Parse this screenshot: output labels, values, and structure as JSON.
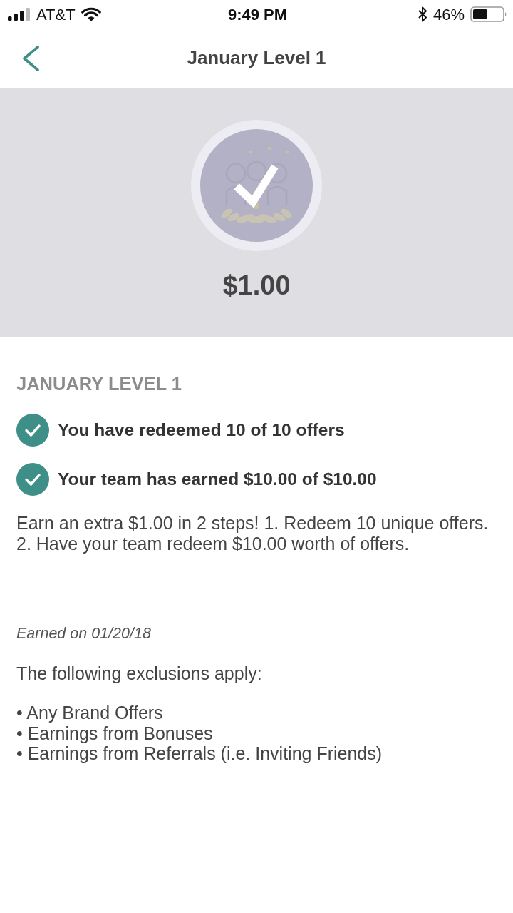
{
  "status_bar": {
    "carrier": "AT&T",
    "time": "9:49 PM",
    "battery": "46%"
  },
  "nav_bar": {
    "title": "January Level 1"
  },
  "hero": {
    "earned": true,
    "amount": "$1.00"
  },
  "section": {
    "heading": "JANUARY LEVEL 1",
    "requirements": [
      {
        "text": "You have redeemed 10 of 10 offers",
        "checked": true
      },
      {
        "text": "Your team has earned $10.00 of $10.00",
        "checked": true
      }
    ],
    "description": "Earn an extra $1.00 in 2 steps! 1. Redeem 10 unique offers. 2. Have your team redeem $10.00 worth of offers.",
    "earned_date": "Earned on 01/20/18",
    "exclusions_heading": "The following exclusions apply:",
    "exclusions": [
      "• Any Brand Offers",
      "• Earnings from Bonuses",
      "• Earnings from Referrals (i.e. Inviting Friends)"
    ]
  }
}
